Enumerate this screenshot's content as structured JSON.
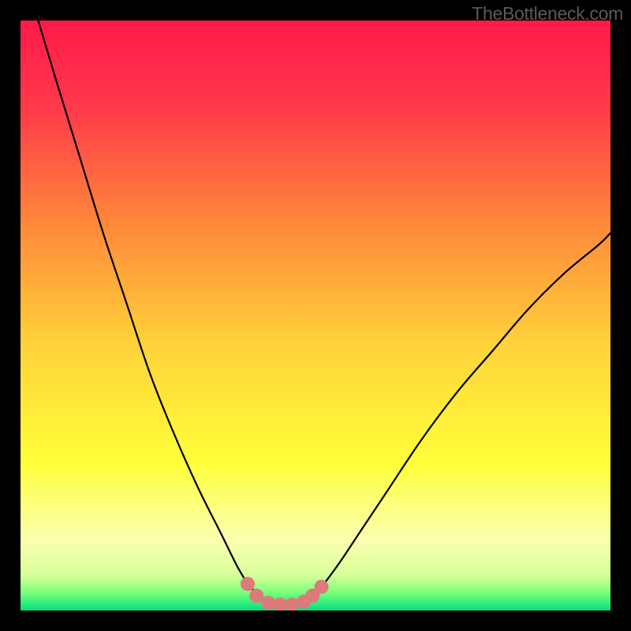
{
  "watermark": "TheBottleneck.com",
  "chart_data": {
    "type": "line",
    "title": "",
    "xlabel": "",
    "ylabel": "",
    "xlim": [
      0,
      100
    ],
    "ylim": [
      0,
      100
    ],
    "background_gradient": {
      "stops": [
        {
          "offset": 0.0,
          "color": "#ff1a4a"
        },
        {
          "offset": 0.15,
          "color": "#ff3a4a"
        },
        {
          "offset": 0.35,
          "color": "#ff8a3a"
        },
        {
          "offset": 0.55,
          "color": "#ffd23a"
        },
        {
          "offset": 0.75,
          "color": "#ffff3a"
        },
        {
          "offset": 0.88,
          "color": "#faffb0"
        },
        {
          "offset": 0.94,
          "color": "#d8ff9a"
        },
        {
          "offset": 0.97,
          "color": "#7aff7a"
        },
        {
          "offset": 1.0,
          "color": "#00e080"
        }
      ]
    },
    "series": [
      {
        "name": "bottleneck-curve",
        "type": "line",
        "stroke": "#000000",
        "points": [
          {
            "x": 3,
            "y": 100
          },
          {
            "x": 6,
            "y": 90
          },
          {
            "x": 10,
            "y": 77
          },
          {
            "x": 14,
            "y": 64
          },
          {
            "x": 18,
            "y": 52
          },
          {
            "x": 22,
            "y": 40
          },
          {
            "x": 26,
            "y": 30
          },
          {
            "x": 30,
            "y": 21
          },
          {
            "x": 34,
            "y": 13
          },
          {
            "x": 37,
            "y": 7
          },
          {
            "x": 39,
            "y": 4
          },
          {
            "x": 41,
            "y": 2
          },
          {
            "x": 43,
            "y": 1
          },
          {
            "x": 46,
            "y": 1
          },
          {
            "x": 49,
            "y": 2
          },
          {
            "x": 51,
            "y": 4
          },
          {
            "x": 54,
            "y": 8
          },
          {
            "x": 58,
            "y": 14
          },
          {
            "x": 62,
            "y": 20
          },
          {
            "x": 68,
            "y": 29
          },
          {
            "x": 74,
            "y": 37
          },
          {
            "x": 80,
            "y": 44
          },
          {
            "x": 86,
            "y": 51
          },
          {
            "x": 92,
            "y": 57
          },
          {
            "x": 98,
            "y": 62
          },
          {
            "x": 100,
            "y": 64
          }
        ]
      },
      {
        "name": "highlight-dots",
        "type": "scatter",
        "color": "#dd7a7a",
        "radius": 9,
        "points": [
          {
            "x": 38.5,
            "y": 4.5
          },
          {
            "x": 40,
            "y": 2.5
          },
          {
            "x": 42,
            "y": 1.3
          },
          {
            "x": 44,
            "y": 1
          },
          {
            "x": 46,
            "y": 1
          },
          {
            "x": 48,
            "y": 1.5
          },
          {
            "x": 49.5,
            "y": 2.5
          },
          {
            "x": 51,
            "y": 4
          }
        ]
      }
    ]
  }
}
